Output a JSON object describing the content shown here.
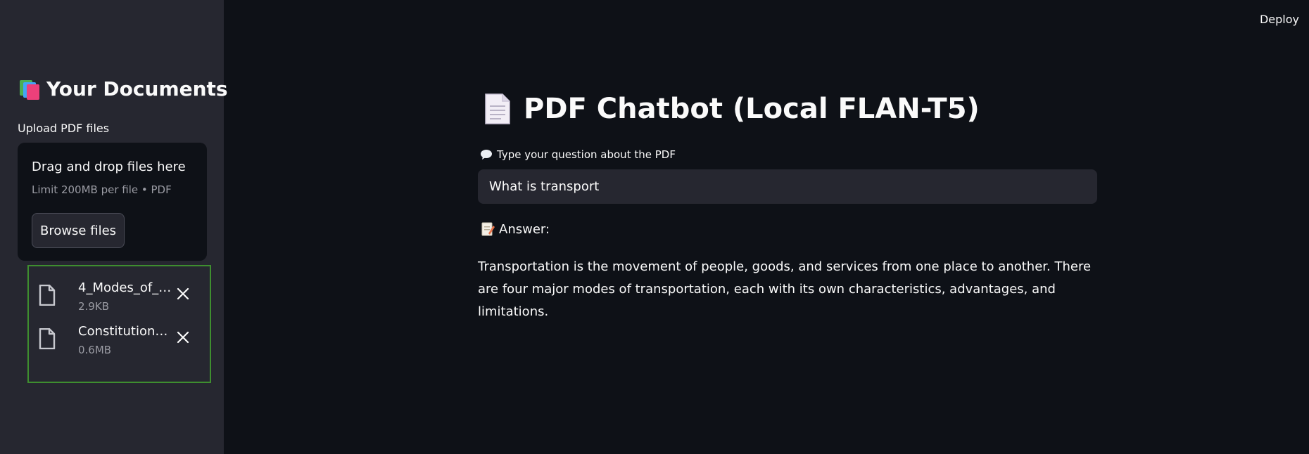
{
  "sidebar": {
    "title": "Your Documents",
    "title_icon": "books-icon",
    "uploader_label": "Upload PDF files",
    "dropzone": {
      "main_text": "Drag and drop files here",
      "limit_text": "Limit 200MB per file • PDF",
      "browse_label": "Browse files"
    },
    "files": [
      {
        "name": "4_Modes_of_…",
        "size": "2.9KB",
        "icon": "file-icon"
      },
      {
        "name": "Constitution_…",
        "size": "0.6MB",
        "icon": "file-icon"
      }
    ]
  },
  "header": {
    "deploy_label": "Deploy"
  },
  "main": {
    "title": "PDF Chatbot (Local FLAN-T5)",
    "title_icon": "page-icon",
    "question_label": "Type your question about the PDF",
    "question_icon": "speech-balloon-icon",
    "question_value": "What is transport",
    "answer_label": "Answer:",
    "answer_icon": "memo-icon",
    "answer_text": "Transportation is the movement of people, goods, and services from one place to another. There are four major modes of transportation, each with its own characteristics, advantages, and limitations."
  },
  "colors": {
    "background": "#0e1117",
    "sidebar": "#262730",
    "input_bg": "#262730",
    "file_list_border": "#3e8e2f",
    "muted_text": "#9a9ba3"
  }
}
